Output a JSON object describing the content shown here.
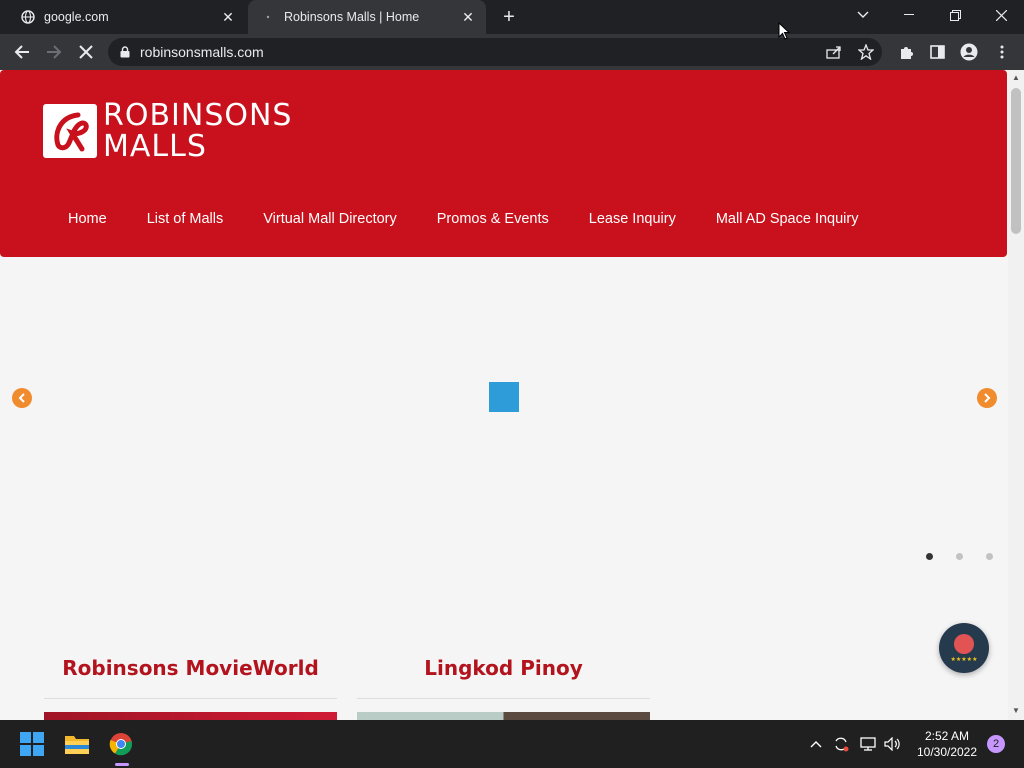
{
  "browser": {
    "tabs": [
      {
        "title": "google.com",
        "active": false
      },
      {
        "title": "Robinsons Malls | Home",
        "active": true
      }
    ],
    "address": "robinsonsmalls.com"
  },
  "site": {
    "logo_line1": "ROBINSONS",
    "logo_line2": "MALLS",
    "brand_color": "#c8111c",
    "nav": [
      "Home",
      "List of Malls",
      "Virtual Mall Directory",
      "Promos & Events",
      "Lease Inquiry",
      "Mall AD Space Inquiry"
    ],
    "slider": {
      "dot_count": 3,
      "active_dot": 0
    },
    "features": [
      {
        "title": "Robinsons MovieWorld"
      },
      {
        "title": "Lingkod Pinoy"
      }
    ]
  },
  "taskbar": {
    "time": "2:52 AM",
    "date": "10/30/2022",
    "notifications": "2"
  }
}
